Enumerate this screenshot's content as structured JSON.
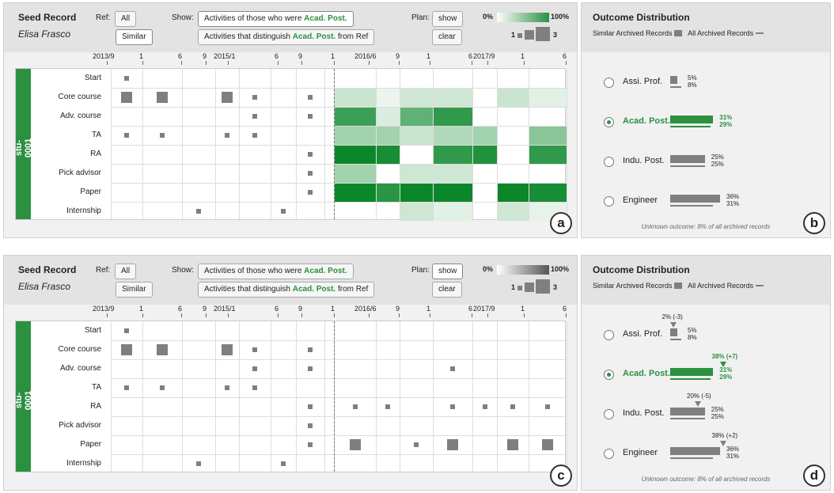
{
  "header": {
    "seed_title": "Seed Record",
    "seed_name": "Elisa Frasco",
    "ref_label": "Ref:",
    "ref_all": "All",
    "ref_similar": "Similar",
    "show_label": "Show:",
    "show1_prefix": "Activities of those who were",
    "show1_outcome": "Acad. Post.",
    "show2_prefix": "Activities that distinguish",
    "show2_outcome": "Acad. Post.",
    "show2_suffix": "from Ref",
    "plan_label": "Plan:",
    "plan_show": "show",
    "plan_clear": "clear",
    "legend_min": "0%",
    "legend_max": "100%",
    "size_min": "1",
    "size_max": "3"
  },
  "timeline": [
    "2013/9",
    "1",
    "6",
    "9",
    "2015/1",
    "6",
    "9",
    "1",
    "2016/6",
    "9",
    "1",
    "6",
    "2017/9",
    "1",
    "6"
  ],
  "student_id": "stu-0001",
  "rows": [
    "Start",
    "Core course",
    "Adv. course",
    "TA",
    "RA",
    "Pick advisor",
    "Paper",
    "Internship"
  ],
  "history_a": [
    [
      [
        1,
        1
      ]
    ],
    [
      [
        1,
        2
      ],
      [
        2,
        2
      ],
      [
        4,
        2
      ],
      [
        5,
        1
      ],
      [
        7,
        1
      ]
    ],
    [
      [
        5,
        1
      ],
      [
        7,
        1
      ]
    ],
    [
      [
        1,
        1
      ],
      [
        2,
        1
      ],
      [
        4,
        1
      ],
      [
        5,
        1
      ]
    ],
    [
      [
        7,
        1
      ]
    ],
    [
      [
        7,
        1
      ]
    ],
    [
      [
        7,
        1
      ]
    ],
    [
      [
        3,
        1
      ],
      [
        6,
        1
      ]
    ]
  ],
  "plan_a": [
    [],
    [
      [
        0,
        0.22
      ],
      [
        1,
        0.08
      ],
      [
        2,
        0.2
      ],
      [
        3,
        0.2
      ],
      [
        5,
        0.22
      ],
      [
        6,
        0.12
      ]
    ],
    [
      [
        0,
        0.8
      ],
      [
        1,
        0.15
      ],
      [
        2,
        0.65
      ],
      [
        3,
        0.85
      ]
    ],
    [
      [
        0,
        0.38
      ],
      [
        1,
        0.38
      ],
      [
        2,
        0.22
      ],
      [
        3,
        0.32
      ],
      [
        4,
        0.38
      ],
      [
        6,
        0.48
      ]
    ],
    [
      [
        0,
        1.0
      ],
      [
        1,
        0.95
      ],
      [
        3,
        0.85
      ],
      [
        4,
        0.92
      ],
      [
        6,
        0.85
      ]
    ],
    [
      [
        0,
        0.38
      ],
      [
        2,
        0.2
      ],
      [
        3,
        0.2
      ]
    ],
    [
      [
        0,
        1.0
      ],
      [
        1,
        0.88
      ],
      [
        2,
        1.0
      ],
      [
        3,
        1.0
      ],
      [
        5,
        1.0
      ],
      [
        6,
        0.95
      ]
    ],
    [
      [
        2,
        0.2
      ],
      [
        3,
        0.12
      ],
      [
        5,
        0.2
      ],
      [
        6,
        0.1
      ]
    ]
  ],
  "history_c": [
    [
      [
        1,
        1
      ]
    ],
    [
      [
        1,
        2
      ],
      [
        2,
        2
      ],
      [
        4,
        2
      ],
      [
        5,
        1
      ],
      [
        7,
        1
      ]
    ],
    [
      [
        5,
        1
      ],
      [
        7,
        1
      ]
    ],
    [
      [
        1,
        1
      ],
      [
        2,
        1
      ],
      [
        4,
        1
      ],
      [
        5,
        1
      ]
    ],
    [
      [
        7,
        1
      ]
    ],
    [
      [
        7,
        1
      ]
    ],
    [
      [
        7,
        1
      ]
    ],
    [
      [
        3,
        1
      ],
      [
        6,
        1
      ]
    ]
  ],
  "plan_c": [
    [],
    [],
    [
      [
        3,
        1
      ]
    ],
    [],
    [
      [
        0,
        1
      ],
      [
        1,
        1
      ],
      [
        3,
        1
      ],
      [
        4,
        1
      ],
      [
        5,
        1
      ],
      [
        6,
        1
      ]
    ],
    [],
    [
      [
        0,
        2
      ],
      [
        2,
        1
      ],
      [
        3,
        2
      ],
      [
        5,
        2
      ],
      [
        6,
        2
      ]
    ],
    []
  ],
  "outcomes": {
    "title": "Outcome Distribution",
    "legend_similar": "Similar Archived Records",
    "legend_all": "All Archived Records",
    "unknown": "Unknown outcome: 8% of all archived records",
    "selected": "Acad. Post.",
    "items": [
      {
        "label": "Assi. Prof.",
        "similar": 5,
        "all": 8,
        "similar_text": "5%",
        "all_text": "8%",
        "plan": 2,
        "plan_text": "2% (-3)"
      },
      {
        "label": "Acad. Post.",
        "similar": 31,
        "all": 29,
        "similar_text": "31%",
        "all_text": "29%",
        "plan": 38,
        "plan_text": "38% (+7)"
      },
      {
        "label": "Indu. Post.",
        "similar": 25,
        "all": 25,
        "similar_text": "25%",
        "all_text": "25%",
        "plan": 20,
        "plan_text": "20% (-5)"
      },
      {
        "label": "Engineer",
        "similar": 36,
        "all": 31,
        "similar_text": "36%",
        "all_text": "31%",
        "plan": 38,
        "plan_text": "38% (+2)"
      }
    ]
  },
  "badges": [
    "a",
    "b",
    "c",
    "d"
  ],
  "colors": {
    "accent": "#2b9040",
    "grey": "#7f7f7f",
    "light_green": "#e8f5e9"
  }
}
